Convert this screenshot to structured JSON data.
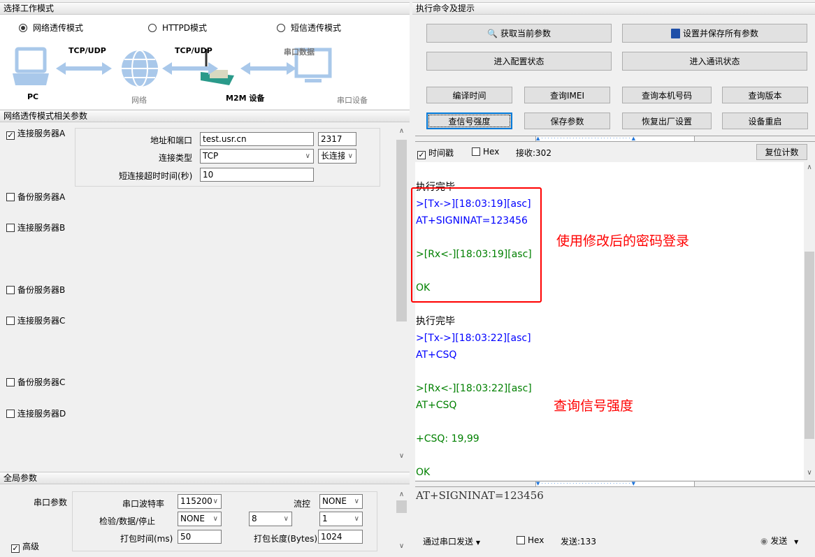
{
  "left": {
    "mode_header": "选择工作模式",
    "modes": [
      {
        "label": "网络透传模式",
        "selected": true
      },
      {
        "label": "HTTPD模式",
        "selected": false
      },
      {
        "label": "短信透传模式",
        "selected": false
      }
    ],
    "diagram": {
      "pc": "PC",
      "link1": "TCP/UDP",
      "network": "网络",
      "link2": "TCP/UDP",
      "m2m": "M2M 设备",
      "link3": "串口数据",
      "serial_device": "串口设备"
    },
    "params_header": "网络透传模式相关参数",
    "servers": [
      {
        "label": "连接服务器A",
        "checked": true
      },
      {
        "label": "备份服务器A",
        "checked": false
      },
      {
        "label": "连接服务器B",
        "checked": false
      },
      {
        "label": "备份服务器B",
        "checked": false
      },
      {
        "label": "连接服务器C",
        "checked": false
      },
      {
        "label": "备份服务器C",
        "checked": false
      },
      {
        "label": "连接服务器D",
        "checked": false
      }
    ],
    "server_a": {
      "addr_label": "地址和端口",
      "addr": "test.usr.cn",
      "port": "2317",
      "type_label": "连接类型",
      "type": "TCP",
      "conn_mode": "长连接",
      "timeout_label": "短连接超时时间(秒)",
      "timeout": "10"
    },
    "global_header": "全局参数",
    "global": {
      "serial_label": "串口参数",
      "baud_label": "串口波特率",
      "baud": "115200",
      "flow_label": "流控",
      "flow": "NONE",
      "parity_label": "检验/数据/停止",
      "parity": "NONE",
      "databits": "8",
      "stopbits": "1",
      "pack_time_label": "打包时间(ms)",
      "pack_time": "50",
      "pack_len_label": "打包长度(Bytes)",
      "pack_len": "1024",
      "advanced_label": "高级",
      "advanced_checked": true
    }
  },
  "right": {
    "header": "执行命令及提示",
    "buttons": {
      "get_params": "获取当前参数",
      "save_all": "设置并保存所有参数",
      "enter_config": "进入配置状态",
      "enter_comm": "进入通讯状态",
      "compile_time": "编译时间",
      "query_imei": "查询IMEI",
      "query_number": "查询本机号码",
      "query_version": "查询版本",
      "query_signal": "查信号强度",
      "save_params": "保存参数",
      "factory_reset": "恢复出厂设置",
      "reboot": "设备重启"
    },
    "toolbar": {
      "timestamp_label": "时间戳",
      "timestamp_checked": true,
      "hex_label": "Hex",
      "hex_checked": false,
      "recv_label": "接收:302",
      "reset_count": "复位计数"
    },
    "log": [
      {
        "text": "执行完毕",
        "color": "black"
      },
      {
        "text": ">[Tx->][18:03:19][asc]",
        "color": "blue"
      },
      {
        "text": "AT+SIGNINAT=123456",
        "color": "blue"
      },
      {
        "text": "",
        "color": "black"
      },
      {
        "text": ">[Rx<-][18:03:19][asc]",
        "color": "green"
      },
      {
        "text": "",
        "color": "black"
      },
      {
        "text": "OK",
        "color": "green"
      },
      {
        "text": "",
        "color": "black"
      },
      {
        "text": "执行完毕",
        "color": "black"
      },
      {
        "text": ">[Tx->][18:03:22][asc]",
        "color": "blue"
      },
      {
        "text": "AT+CSQ",
        "color": "blue"
      },
      {
        "text": "",
        "color": "black"
      },
      {
        "text": ">[Rx<-][18:03:22][asc]",
        "color": "green"
      },
      {
        "text": "AT+CSQ",
        "color": "green"
      },
      {
        "text": "",
        "color": "black"
      },
      {
        "text": "+CSQ: 19,99",
        "color": "green"
      },
      {
        "text": "",
        "color": "black"
      },
      {
        "text": "OK",
        "color": "green"
      }
    ],
    "annotations": {
      "login": "使用修改后的密码登录",
      "signal": "查询信号强度"
    },
    "send_input": "AT+SIGNINAT=123456",
    "send_bar": {
      "via": "通过串口发送",
      "hex_label": "Hex",
      "hex_checked": false,
      "sent_label": "发送:133",
      "send": "发送"
    }
  },
  "colors": {
    "tx": "#0000ff",
    "rx": "#008000",
    "annotation": "#ff0000",
    "focus": "#0078d7"
  }
}
